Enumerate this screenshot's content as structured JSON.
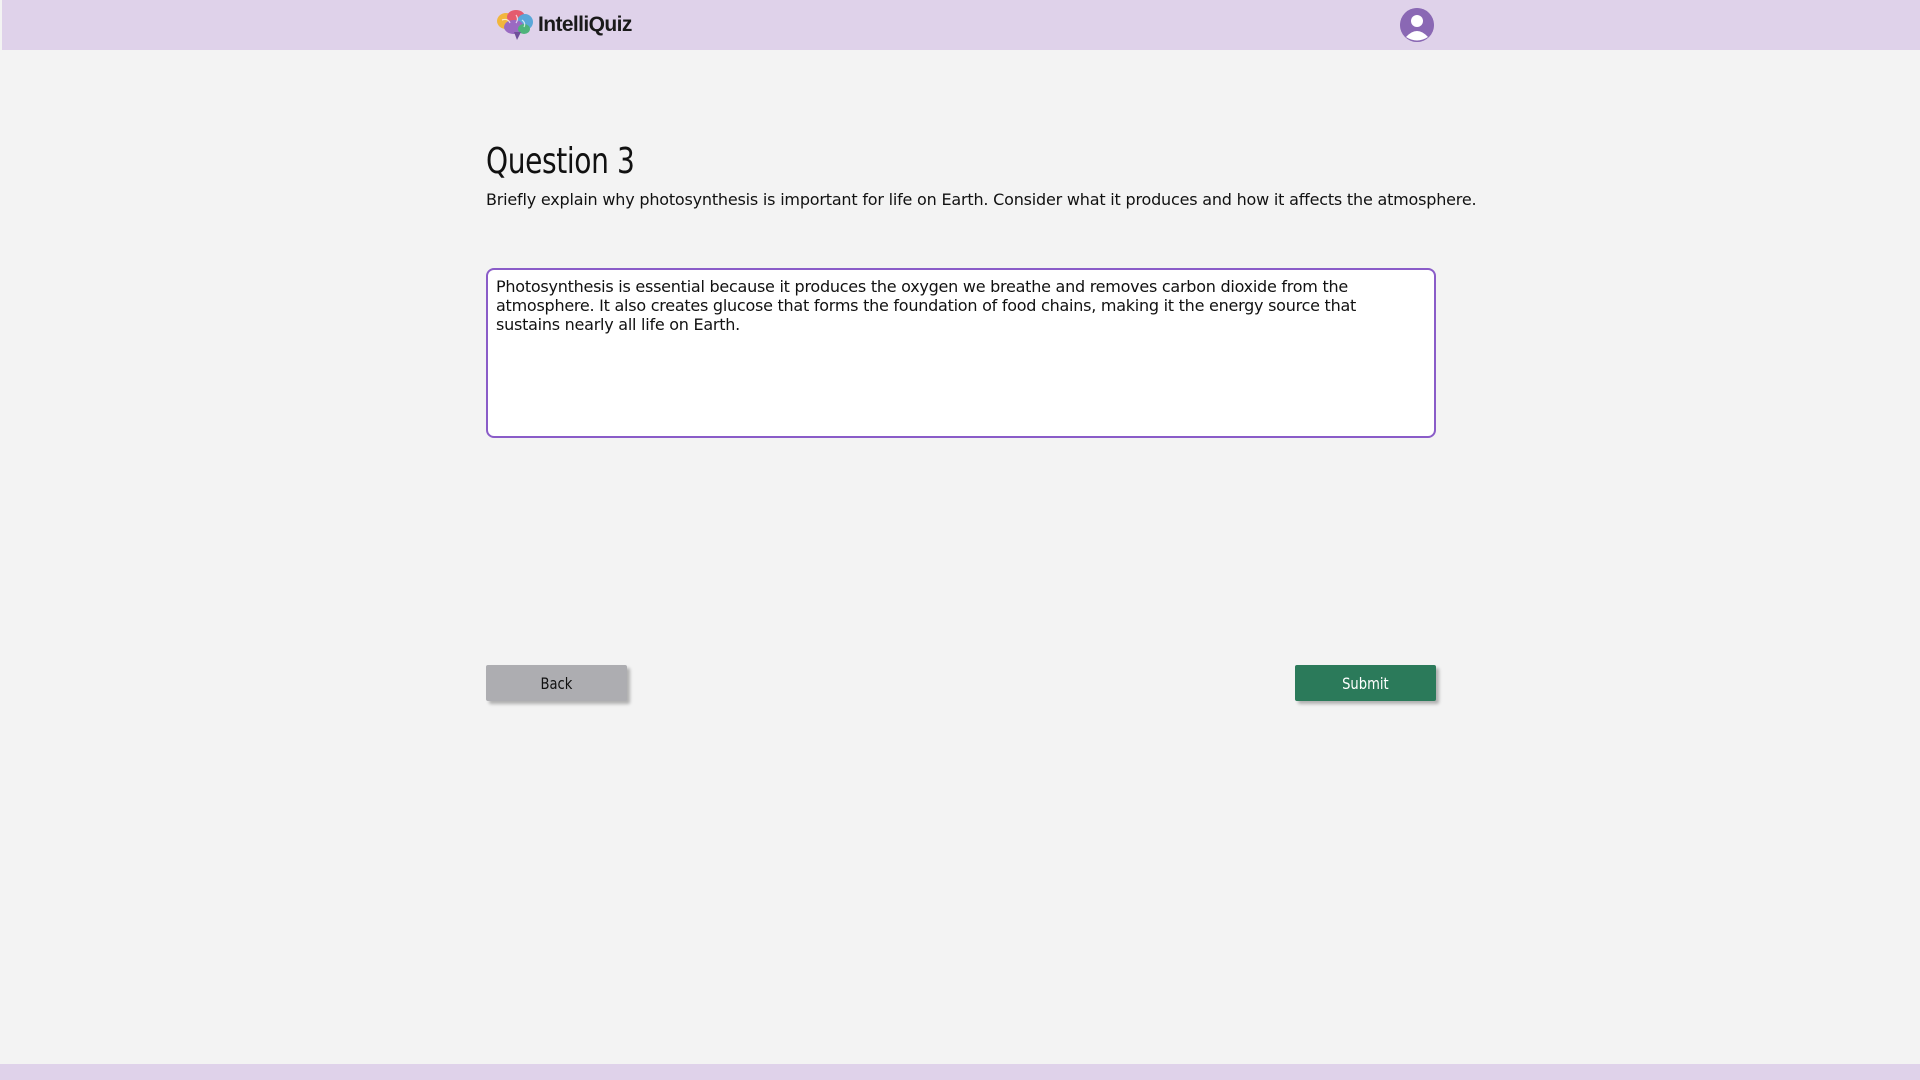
{
  "app": {
    "name": "IntelliQuiz"
  },
  "header": {
    "logo_icon": "brain-icon",
    "avatar_icon": "user-avatar-icon"
  },
  "question": {
    "title": "Question 3",
    "prompt": "Briefly explain why photosynthesis is important for life on Earth. Consider what it produces and how it affects the atmosphere."
  },
  "answer": {
    "value": "Photosynthesis is essential because it produces the oxygen we breathe and removes carbon dioxide from the atmosphere. It also creates glucose that forms the foundation of food chains, making it the energy source that sustains nearly all life on Earth."
  },
  "actions": {
    "back_label": "Back",
    "submit_label": "Submit"
  },
  "colors": {
    "header_bg": "#dfd2ea",
    "page_bg": "#f3f3f3",
    "accent": "#8a5cc8",
    "submit_bg": "#2b7a5a",
    "back_bg": "#adadb1"
  }
}
